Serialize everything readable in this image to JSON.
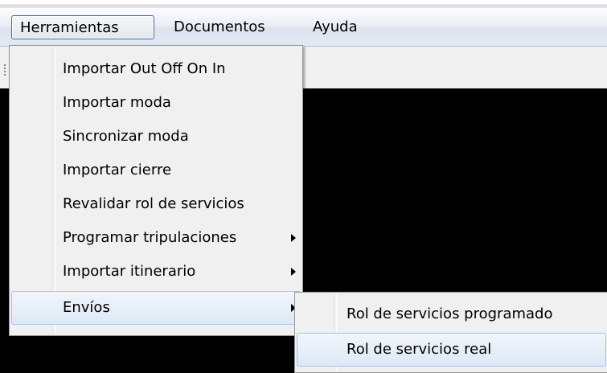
{
  "menubar": {
    "items": [
      {
        "label": "Herramientas"
      },
      {
        "label": "Documentos"
      },
      {
        "label": "Ayuda"
      }
    ]
  },
  "herramientas_menu": {
    "items": [
      {
        "label": "Importar Out Off On In",
        "has_submenu": false
      },
      {
        "label": "Importar moda",
        "has_submenu": false
      },
      {
        "label": "Sincronizar moda",
        "has_submenu": false
      },
      {
        "label": "Importar cierre",
        "has_submenu": false
      },
      {
        "label": "Revalidar rol de servicios",
        "has_submenu": false
      },
      {
        "label": "Programar tripulaciones",
        "has_submenu": true
      },
      {
        "label": "Importar itinerario",
        "has_submenu": true
      },
      {
        "label": "Envíos",
        "has_submenu": true,
        "highlighted": true
      }
    ]
  },
  "envios_submenu": {
    "items": [
      {
        "label": "Rol de servicios programado"
      },
      {
        "label": "Rol de servicios real",
        "highlighted": true
      }
    ]
  },
  "colors": {
    "background": "#000000",
    "menu_background": "#f0f0f0",
    "hover_border": "#a8c2e4"
  }
}
